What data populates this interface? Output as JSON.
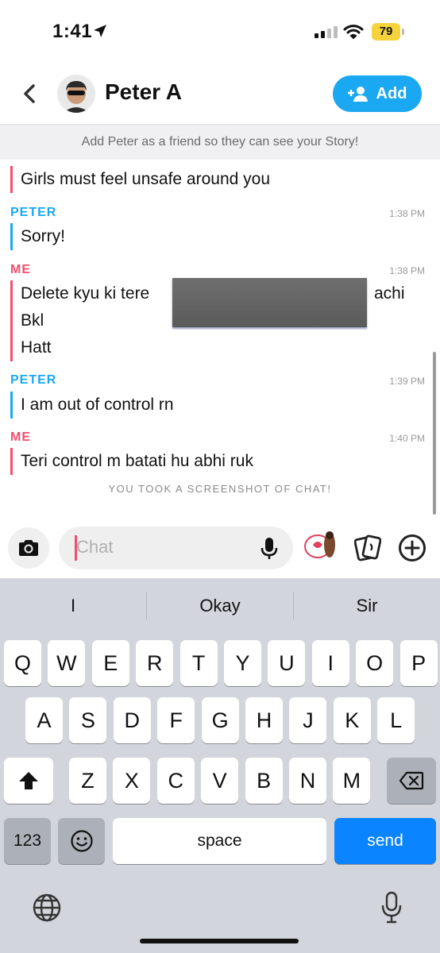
{
  "status": {
    "time": "1:41",
    "battery": "79"
  },
  "header": {
    "name": "Peter A",
    "add_label": "Add"
  },
  "banner": "Add Peter as a friend so they can see your Story!",
  "chat": {
    "top_cut": "Girls must feel unsafe around you",
    "groups": [
      {
        "sender": "PETER",
        "time": "1:38 PM",
        "lines": [
          "Sorry!"
        ]
      },
      {
        "sender": "ME",
        "time": "1:38 PM",
        "lines": [
          "Delete kyu ki tere",
          "Bkl",
          "Hatt"
        ],
        "line1_tail": "achi"
      },
      {
        "sender": "PETER",
        "time": "1:39 PM",
        "lines": [
          "I am out of control rn"
        ]
      },
      {
        "sender": "ME",
        "time": "1:40 PM",
        "lines": [
          "Teri control m batati hu abhi ruk"
        ]
      }
    ],
    "screenshot_note": "YOU TOOK A SCREENSHOT OF CHAT!"
  },
  "input": {
    "placeholder": "Chat"
  },
  "keyboard": {
    "suggestions": [
      "I",
      "Okay",
      "Sir"
    ],
    "row1": [
      "Q",
      "W",
      "E",
      "R",
      "T",
      "Y",
      "U",
      "I",
      "O",
      "P"
    ],
    "row2": [
      "A",
      "S",
      "D",
      "F",
      "G",
      "H",
      "J",
      "K",
      "L"
    ],
    "row3": [
      "Z",
      "X",
      "C",
      "V",
      "B",
      "N",
      "M"
    ],
    "num_key": "123",
    "space": "space",
    "send": "send"
  },
  "icons": [
    "location-arrow-icon",
    "signal-icon",
    "wifi-icon",
    "back-chevron-icon",
    "add-friend-icon",
    "camera-icon",
    "microphone-icon",
    "sticker-icon",
    "cards-icon",
    "plus-icon",
    "shift-icon",
    "backspace-icon",
    "emoji-icon",
    "globe-icon",
    "dictation-icon"
  ],
  "colors": {
    "accent": "#1aa8f2",
    "me": "#f0506e",
    "send": "#0a84ff",
    "battery": "#f6d33c"
  }
}
